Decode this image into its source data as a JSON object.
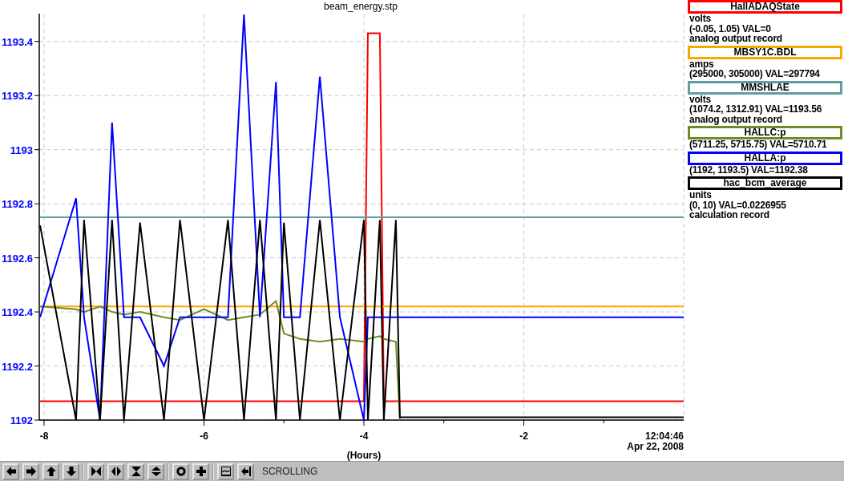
{
  "chart": {
    "chart_data": {
      "type": "line",
      "title": "beam_energy.stp",
      "xlabel": "(Hours)",
      "x": [
        -8.05,
        -7.6,
        -7.5,
        -7.3,
        -7.15,
        -7.0,
        -6.8,
        -6.5,
        -6.3,
        -6.0,
        -5.7,
        -5.5,
        -5.3,
        -5.1,
        -5.0,
        -4.8,
        -4.55,
        -4.3,
        -4.0,
        -3.95,
        -3.8,
        -3.75,
        -3.6,
        -3.55,
        -2,
        0
      ],
      "series": [
        {
          "name": "HallADAQState",
          "color": "#ff0000",
          "values": [
            1192.07,
            1192.07,
            1192.07,
            1192.07,
            1192.07,
            1192.07,
            1192.07,
            1192.07,
            1192.07,
            1192.07,
            1192.07,
            1192.07,
            1192.07,
            1192.07,
            1192.07,
            1192.07,
            1192.07,
            1192.07,
            1192.07,
            1193.43,
            1193.43,
            1192.07,
            1192.07,
            1192.07,
            1192.07,
            1192.07
          ]
        },
        {
          "name": "MBSY1C.BDL",
          "color": "#ffa500",
          "values": [
            1192.42,
            1192.42,
            1192.42,
            1192.42,
            1192.42,
            1192.42,
            1192.42,
            1192.42,
            1192.42,
            1192.42,
            1192.42,
            1192.42,
            1192.42,
            1192.42,
            1192.42,
            1192.42,
            1192.42,
            1192.42,
            1192.42,
            1192.42,
            1192.42,
            1192.42,
            1192.42,
            1192.42,
            1192.42,
            1192.42
          ]
        },
        {
          "name": "MMSHLAE",
          "color": "#5f9ea0",
          "values": [
            1192.75,
            1192.75,
            1192.75,
            1192.75,
            1192.75,
            1192.75,
            1192.75,
            1192.75,
            1192.75,
            1192.75,
            1192.75,
            1192.75,
            1192.75,
            1192.75,
            1192.75,
            1192.75,
            1192.75,
            1192.75,
            1192.75,
            1192.75,
            1192.75,
            1192.75,
            1192.75,
            1192.75,
            1192.75,
            1192.75
          ]
        },
        {
          "name": "HALLC:p",
          "color": "#6b8e23",
          "values": [
            1192.42,
            1192.41,
            1192.4,
            1192.42,
            1192.4,
            1192.39,
            1192.4,
            1192.38,
            1192.37,
            1192.41,
            1192.37,
            1192.38,
            1192.39,
            1192.44,
            1192.32,
            1192.3,
            1192.29,
            1192.3,
            1192.29,
            1192.3,
            1192.31,
            1192.3,
            1192.29,
            1192.0,
            null,
            null
          ]
        },
        {
          "name": "HALLA:p",
          "color": "#0000ff",
          "values": [
            1192.38,
            1192.82,
            1192.38,
            1192.0,
            1193.1,
            1192.38,
            1192.38,
            1192.2,
            1192.38,
            1192.38,
            1192.38,
            1193.5,
            1192.38,
            1193.25,
            1192.38,
            1192.38,
            1193.27,
            1192.38,
            1192.0,
            1192.38,
            1192.38,
            1192.38,
            1192.38,
            1192.38,
            1192.38,
            1192.38
          ]
        },
        {
          "name": "hac_bcm_average",
          "color": "#000000",
          "values": [
            1192.72,
            1192.0,
            1192.74,
            1192.0,
            1192.74,
            1192.0,
            1192.73,
            1192.0,
            1192.74,
            1192.0,
            1192.74,
            1192.0,
            1192.74,
            1192.0,
            1192.73,
            1192.0,
            1192.74,
            1192.0,
            1192.74,
            1192.0,
            1192.74,
            1192.0,
            1192.74,
            1192.01,
            1192.01,
            1192.01
          ]
        }
      ],
      "grid": true,
      "xlim": [
        -8.06,
        0
      ],
      "ylim": [
        1192,
        1193.5
      ],
      "xticks": [
        -8,
        -6,
        -4,
        -2
      ],
      "yticks": [
        {
          "value": 1192,
          "label": "1192"
        },
        {
          "value": 1192.2,
          "label": "1192.2"
        },
        {
          "value": 1192.4,
          "label": "1192.4"
        },
        {
          "value": 1192.6,
          "label": "1192.6"
        },
        {
          "value": 1192.8,
          "label": "1192.8"
        },
        {
          "value": 1193,
          "label": "1193"
        },
        {
          "value": 1193.2,
          "label": "1193.2"
        },
        {
          "value": 1193.4,
          "label": "1193.4"
        }
      ]
    },
    "time": "12:04:46",
    "date": "Apr 22, 2008"
  },
  "legend": {
    "items": [
      {
        "lines": [
          "volts",
          "(-0.05, 1.05) VAL=0",
          "analog output record"
        ]
      },
      {
        "lines": [
          "amps",
          "(295000, 305000) VAL=297794"
        ]
      },
      {
        "lines": [
          "volts",
          "(1074.2, 1312.91)  VAL=1193.56",
          "analog output record"
        ]
      },
      {
        "lines": [
          "(5711.25, 5715.75) VAL=5710.71"
        ]
      },
      {
        "lines": [
          "(1192, 1193.5) VAL=1192.38"
        ]
      },
      {
        "lines": [
          "units",
          "(0, 10) VAL=0.0226955",
          "calculation record"
        ]
      }
    ]
  },
  "toolbar": {
    "groups": [
      {
        "buttons": [
          {
            "kind": "left"
          },
          {
            "kind": "right"
          },
          {
            "kind": "up"
          },
          {
            "kind": "down"
          }
        ]
      },
      {
        "buttons": [
          {
            "kind": "squeeze-x"
          },
          {
            "kind": "spread-x"
          },
          {
            "kind": "squeeze-y"
          },
          {
            "kind": "spread-y"
          }
        ]
      },
      {
        "buttons": [
          {
            "kind": "ring"
          },
          {
            "kind": "plus"
          }
        ]
      },
      {
        "buttons": [
          {
            "kind": "graph"
          },
          {
            "kind": "bar-arrow"
          }
        ]
      }
    ],
    "status": "SCROLLING"
  }
}
